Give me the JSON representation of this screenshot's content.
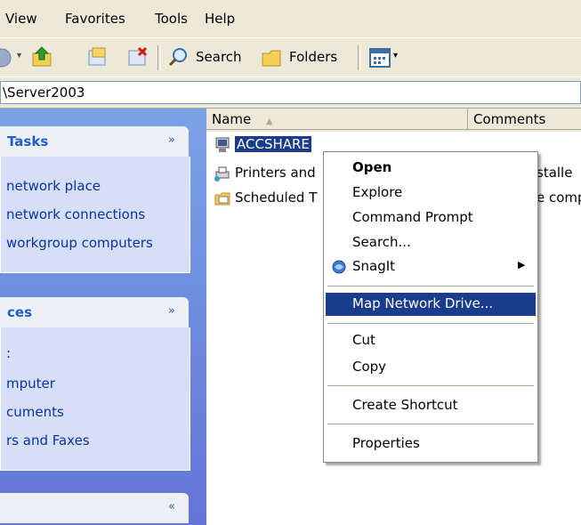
{
  "menubar": {
    "items": [
      "View",
      "Favorites",
      "Tools",
      "Help"
    ]
  },
  "toolbar": {
    "search_label": "Search",
    "folders_label": "Folders"
  },
  "address": {
    "value": "\\Server2003"
  },
  "tasks_panel": {
    "title": "Tasks",
    "links": [
      "network place",
      "network connections",
      "workgroup computers"
    ]
  },
  "places_panel": {
    "title": "ces",
    "links": [
      "mputer",
      "cuments",
      "rs and Faxes"
    ]
  },
  "details_panel": {
    "title": ""
  },
  "list": {
    "columns": [
      "Name",
      "Comments"
    ],
    "rows": [
      {
        "name": "ACCSHARE",
        "comment": ""
      },
      {
        "name": "Printers and",
        "comment": "stalle"
      },
      {
        "name": "Scheduled T",
        "comment": "e comp"
      }
    ]
  },
  "context_menu": {
    "items": [
      "Open",
      "Explore",
      "Command Prompt",
      "Search...",
      "SnagIt",
      "Map Network Drive...",
      "Cut",
      "Copy",
      "Create Shortcut",
      "Properties"
    ],
    "highlighted": "Map Network Drive...",
    "highlight_color": "#1a3c8c"
  },
  "colors": {
    "taskpane": "#6f88dc",
    "chrome": "#ece9d8"
  }
}
